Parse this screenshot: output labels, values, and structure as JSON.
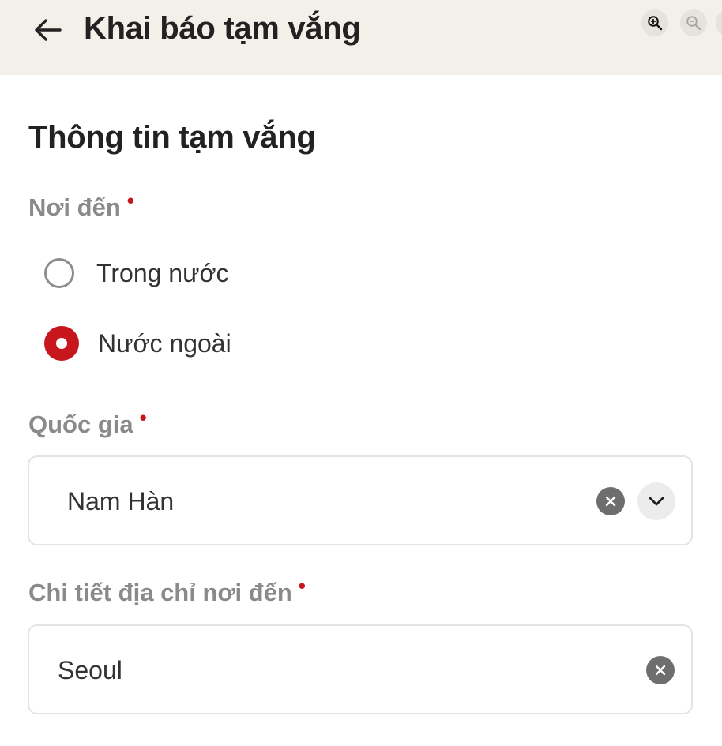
{
  "header": {
    "title": "Khai báo tạm vắng",
    "back_icon": "arrow-left-icon",
    "zoom_in_icon": "zoom-in-icon",
    "zoom_out_icon": "zoom-out-icon",
    "background_color": "#f3efe9"
  },
  "form": {
    "section_title": "Thông tin tạm vắng",
    "required_mark": "•",
    "accent_color": "#c8161d",
    "destination": {
      "label": "Nơi đến",
      "options": [
        {
          "label": "Trong nước",
          "selected": false
        },
        {
          "label": "Nước ngoài",
          "selected": true
        }
      ]
    },
    "country": {
      "label": "Quốc gia",
      "value": "Nam Hàn",
      "clear_icon": "clear-icon",
      "dropdown_icon": "chevron-down-icon"
    },
    "address_detail": {
      "label": "Chi tiết địa chỉ nơi đến",
      "value": "Seoul",
      "clear_icon": "clear-icon"
    }
  }
}
